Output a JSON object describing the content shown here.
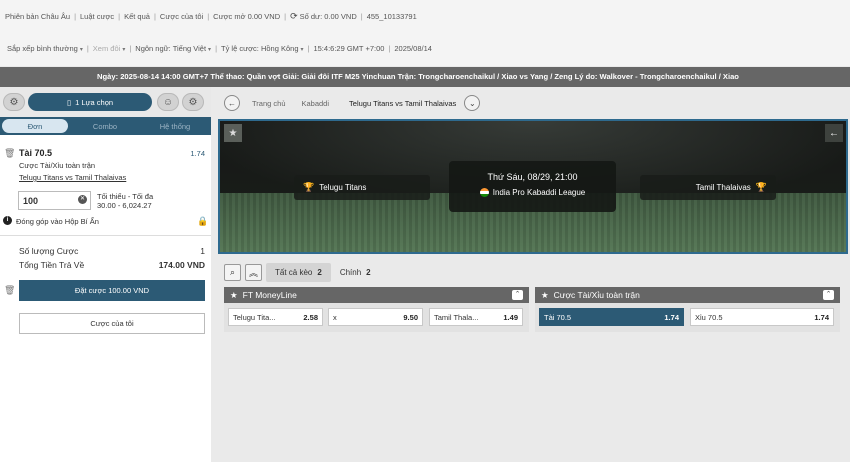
{
  "nav1": {
    "items": [
      "Phiên bản Châu Âu",
      "Luật cược",
      "Kết quả",
      "Cược của tôi",
      "Cược mở 0.00 VND"
    ],
    "balance": "Số dư: 0.00 VND",
    "account_id": "455_10133791"
  },
  "nav2": {
    "sort": "Sắp xếp bình thường",
    "view": "Xem đôi",
    "language": "Ngôn ngữ: Tiếng Việt",
    "odds_format": "Tỷ lệ cược: Hồng Kông",
    "time": "15:4:6:29 GMT +7:00",
    "date": "2025/08/14"
  },
  "ticker": "Ngày: 2025-08-14 14:00 GMT+7 Thể thao: Quần vợt Giải: Giải đôi ITF M25 Yinchuan Trận: Trongcharoenchaikul / Xiao vs Yang / Zeng Lý do: Walkover - Trongcharoenchaikul / Xiao",
  "betslip": {
    "count_label": "1 Lựa chọn",
    "modes": [
      "Đơn",
      "Combo",
      "Hệ thống"
    ],
    "selection": {
      "title": "Tài 70.5",
      "odds": "1.74",
      "market": "Cược Tài/Xỉu toàn trận",
      "match": "Telugu Titans vs Tamil Thalaivas",
      "stake": "100",
      "min_max_label": "Tối thiểu - Tối đa",
      "min_max_value": "30.00 - 6,024.27"
    },
    "contribute": "Đóng góp vào Hộp Bí Ẩn",
    "bet_count_label": "Số lượng Cược",
    "bet_count_value": "1",
    "total_return_label": "Tổng Tiền Trả Về",
    "total_return_value": "174.00 VND",
    "place_bet": "Đặt cược 100.00 VND",
    "my_bets": "Cược của tôi"
  },
  "breadcrumb": [
    "Trang chủ",
    "Kabaddi",
    "Telugu Titans vs Tamil Thalaivas"
  ],
  "hero": {
    "home": "Telugu Titans",
    "away": "Tamil Thalaivas",
    "date": "Thứ Sáu, 08/29, 21:00",
    "league": "India Pro Kabaddi League"
  },
  "tabs": [
    {
      "label": "Tất cả kèo",
      "count": "2"
    },
    {
      "label": "Chính",
      "count": "2"
    }
  ],
  "markets": [
    {
      "title": "FT MoneyLine",
      "odds": [
        {
          "name": "Telugu Tita...",
          "price": "2.58"
        },
        {
          "name": "x",
          "price": "9.50"
        },
        {
          "name": "Tamil Thala...",
          "price": "1.49"
        }
      ]
    },
    {
      "title": "Cược Tài/Xỉu toàn trận",
      "odds": [
        {
          "name": "Tài 70.5",
          "price": "1.74"
        },
        {
          "name": "Xỉu 70.5",
          "price": "1.74"
        }
      ]
    }
  ],
  "colors": {
    "accent": "#2c5a75",
    "header_gray": "#666666",
    "trophy": "#e6b93a"
  }
}
